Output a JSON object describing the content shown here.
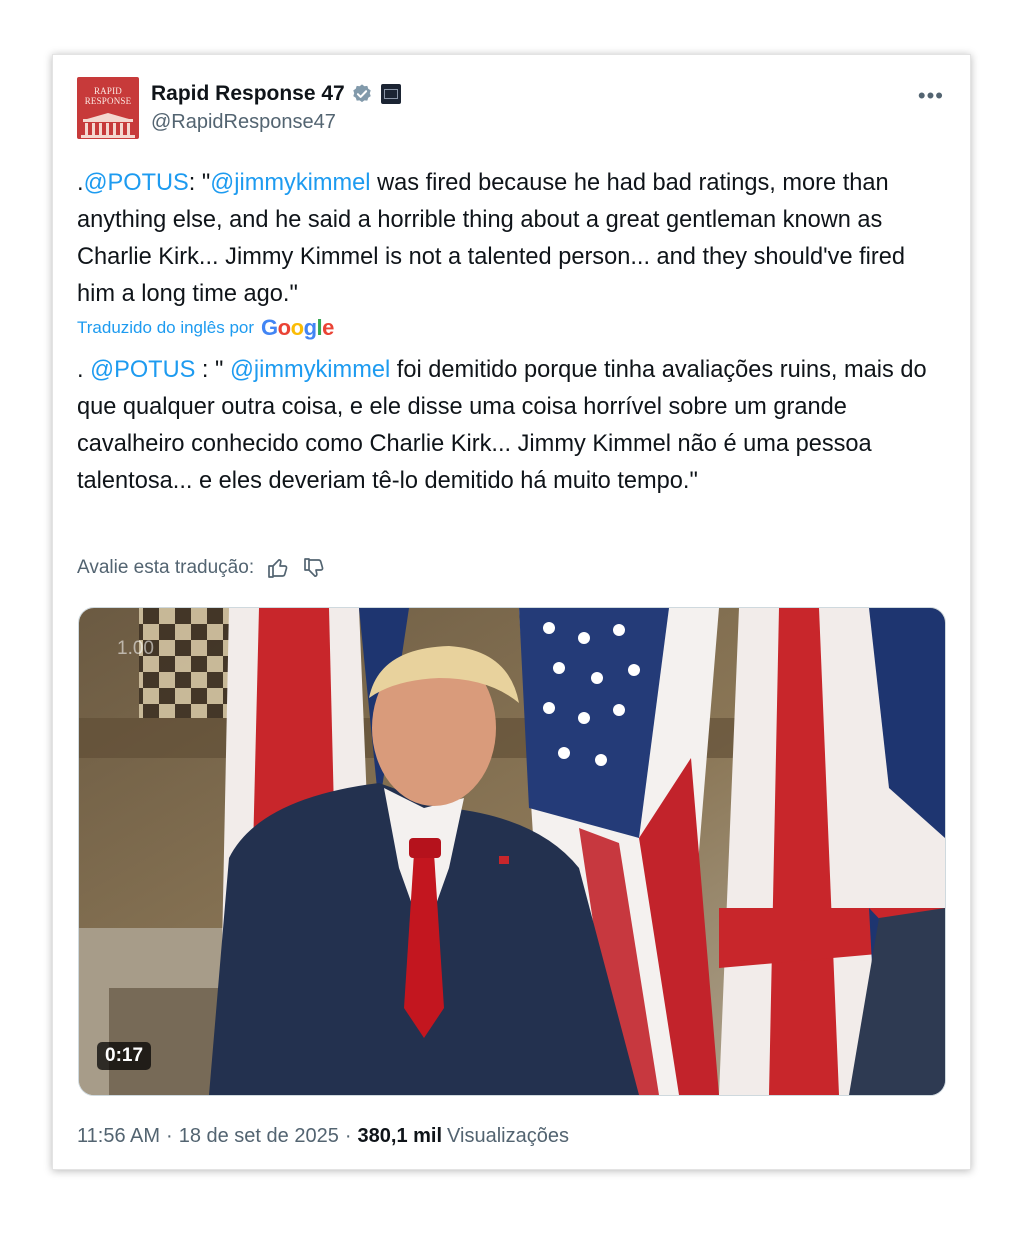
{
  "post": {
    "author": {
      "display_name": "Rapid Response 47",
      "handle": "@RapidResponse47",
      "avatar_text": "RAPID RESPONSE",
      "verified_icon": "verified-badge-icon",
      "affiliation_icon": "white-house-badge-icon"
    },
    "more_label": "•••",
    "text": {
      "prefix": ".",
      "mention1": "@POTUS",
      "part1": ": \"",
      "mention2": "@jimmykimmel",
      "part2": " was fired because he had bad ratings, more than anything else, and he said a horrible thing about a great gentleman known as Charlie Kirk... Jimmy Kimmel is not a talented person... and they should've fired him a long time ago.\""
    },
    "translated_label": "Traduzido do inglês por",
    "translation_provider": "Google",
    "translation": {
      "prefix": ". ",
      "mention1": "@POTUS",
      "part1": " : \" ",
      "mention2": "@jimmykimmel",
      "part2": " foi demitido porque tinha avaliações ruins, mais do que qualquer outra coisa, e ele disse uma coisa horrível sobre um grande cavalheiro conhecido como Charlie Kirk... Jimmy Kimmel não é uma pessoa talentosa... e eles deveriam tê-lo demitido há muito tempo.\""
    },
    "rate_label": "Avalie esta tradução:",
    "video": {
      "playback_rate": "1.00",
      "duration": "0:17"
    },
    "meta": {
      "time": "11:56 AM",
      "date": "18 de set de 2025",
      "views_count": "380,1 mil",
      "views_label": "Visualizações"
    }
  },
  "colors": {
    "link": "#1d9bf0",
    "text": "#0f1419",
    "secondary": "#536471",
    "verified": "#829aab",
    "avatar": "#c73a3a"
  }
}
